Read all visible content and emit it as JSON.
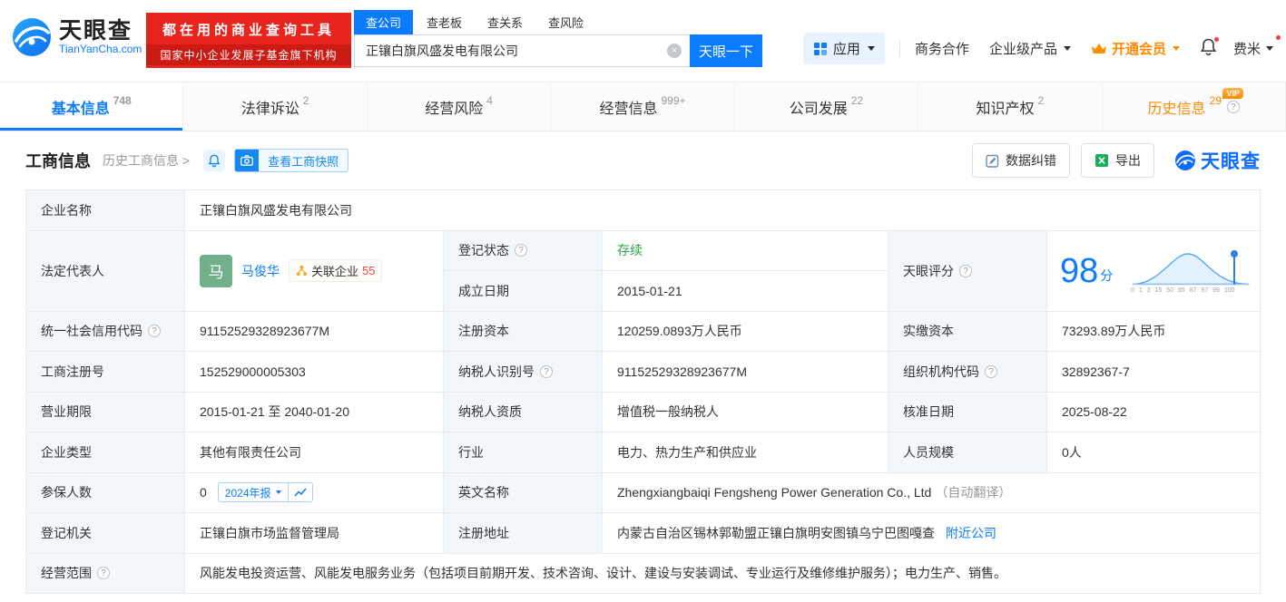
{
  "header": {
    "logo": {
      "title": "天眼查",
      "domain": "TianYanCha.com"
    },
    "slogan": {
      "line1": "都在用的商业查询工具",
      "line2": "国家中小企业发展子基金旗下机构"
    },
    "search": {
      "tabs": [
        "查公司",
        "查老板",
        "查关系",
        "查风险"
      ],
      "value": "正镶白旗风盛发电有限公司",
      "button": "天眼一下"
    },
    "nav": {
      "apps": "应用",
      "cooperation": "商务合作",
      "enterprise_products": "企业级产品",
      "vip": "开通会员",
      "username": "费米"
    }
  },
  "tabs": [
    {
      "label": "基本信息",
      "count": "748"
    },
    {
      "label": "法律诉讼",
      "count": "2"
    },
    {
      "label": "经营风险",
      "count": "4"
    },
    {
      "label": "经营信息",
      "count": "999+"
    },
    {
      "label": "公司发展",
      "count": "22"
    },
    {
      "label": "知识产权",
      "count": "2"
    },
    {
      "label": "历史信息",
      "count": "29",
      "vip_tag": "VIP"
    }
  ],
  "toolbar": {
    "title": "工商信息",
    "history_link": "历史工商信息 >",
    "snapshot_button": "查看工商快照",
    "correction_button": "数据纠错",
    "export_button": "导出",
    "brand": "天眼查"
  },
  "info": {
    "company_name_label": "企业名称",
    "company_name": "正镶白旗风盛发电有限公司",
    "legal_rep_label": "法定代表人",
    "legal_rep_avatar": "马",
    "legal_rep_name": "马俊华",
    "related_label": "关联企业",
    "related_count": "55",
    "reg_status_label": "登记状态",
    "reg_status": "存续",
    "establish_label": "成立日期",
    "establish_date": "2015-01-21",
    "score_label": "天眼评分",
    "score": "98",
    "score_unit": "分",
    "score_axis": "0 1 3 15 50 65 87 97 99 100",
    "credit_code_label": "统一社会信用代码",
    "credit_code": "91152529328923677M",
    "reg_capital_label": "注册资本",
    "reg_capital": "120259.0893万人民币",
    "paid_capital_label": "实缴资本",
    "paid_capital": "73293.89万人民币",
    "reg_number_label": "工商注册号",
    "reg_number": "152529000005303",
    "taxpayer_id_label": "纳税人识别号",
    "taxpayer_id": "91152529328923677M",
    "org_code_label": "组织机构代码",
    "org_code": "32892367-7",
    "term_label": "营业期限",
    "term": "2015-01-21 至 2040-01-20",
    "taxpayer_quality_label": "纳税人资质",
    "taxpayer_quality": "增值税一般纳税人",
    "approval_date_label": "核准日期",
    "approval_date": "2025-08-22",
    "company_type_label": "企业类型",
    "company_type": "其他有限责任公司",
    "industry_label": "行业",
    "industry": "电力、热力生产和供应业",
    "staff_size_label": "人员规模",
    "staff_size": "0人",
    "insured_label": "参保人数",
    "insured_count": "0",
    "annual_report": "2024年报",
    "english_name_label": "英文名称",
    "english_name": "Zhengxiangbaiqi Fengsheng Power Generation Co., Ltd",
    "auto_translate": "（自动翻译）",
    "reg_authority_label": "登记机关",
    "reg_authority": "正镶白旗市场监督管理局",
    "address_label": "注册地址",
    "address": "内蒙古自治区锡林郭勒盟正镶白旗明安图镇乌宁巴图嘎查",
    "nearby_link": "附近公司",
    "scope_label": "经营范围",
    "scope": "风能发电投资运营、风能发电服务业务（包括项目前期开发、技术咨询、设计、建设与安装调试、专业运行及维修维护服务）；电力生产、销售。"
  },
  "colors": {
    "accent_blue": "#0b7cff",
    "status_green": "#2ba245",
    "vip_orange": "#ff8a00",
    "brand_red": "#e8241d"
  }
}
